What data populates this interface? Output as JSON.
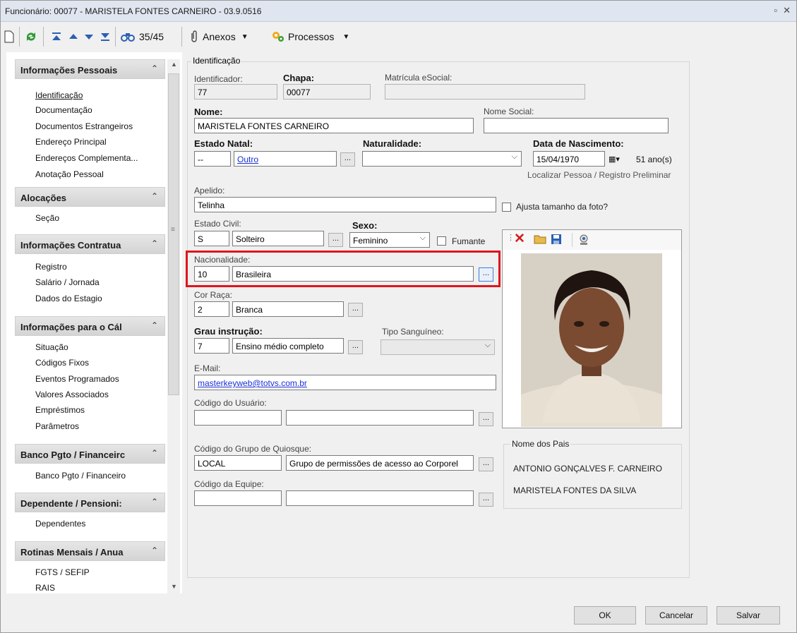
{
  "window": {
    "title": "Funcionário: 00077 - MARISTELA FONTES CARNEIRO - 03.9.0516"
  },
  "toolbar": {
    "counter": "35/45",
    "attachments_label": "Anexos",
    "processes_label": "Processos"
  },
  "sidebar": {
    "sections": [
      {
        "title": "Informações Pessoais",
        "items": [
          "Identificação",
          "Documentação",
          "Documentos Estrangeiros",
          "Endereço Principal",
          "Endereços Complementa...",
          "Anotação Pessoal"
        ]
      },
      {
        "title": "Alocações",
        "items": [
          "Seção"
        ]
      },
      {
        "title": "Informações Contratua",
        "items": [
          "Registro",
          "Salário / Jornada",
          "Dados do Estagio"
        ]
      },
      {
        "title": "Informações para o Cál",
        "items": [
          "Situação",
          "Códigos Fixos",
          "Eventos Programados",
          "Valores Associados",
          "Empréstimos",
          "Parâmetros"
        ]
      },
      {
        "title": "Banco Pgto / Financeirc",
        "items": [
          "Banco Pgto / Financeiro"
        ]
      },
      {
        "title": "Dependente / Pensioni:",
        "items": [
          "Dependentes"
        ]
      },
      {
        "title": "Rotinas Mensais / Anua",
        "items": [
          "FGTS / SEFIP",
          "RAIS"
        ]
      }
    ]
  },
  "form": {
    "group_title": "Identificação",
    "identificador_label": "Identificador:",
    "identificador": "77",
    "chapa_label": "Chapa:",
    "chapa": "00077",
    "matricula_label": "Matrícula eSocial:",
    "matricula": "",
    "nome_label": "Nome:",
    "nome": "MARISTELA FONTES CARNEIRO",
    "nome_social_label": "Nome Social:",
    "nome_social": "",
    "estado_natal_label_a": "Estado",
    "estado_natal_label_b": "Natal:",
    "estado_natal_code": "--",
    "estado_natal_desc": "Outro",
    "naturalidade_label": "Naturalidade:",
    "naturalidade": "",
    "nascimento_label": "Data de Nascimento:",
    "nascimento": "15/04/1970",
    "idade": "51 ano(s)",
    "localizar_link": "Localizar Pessoa / Registro Preliminar",
    "apelido_label": "Apelido:",
    "apelido": "Telinha",
    "ajusta_foto_label": "Ajusta tamanho da foto?",
    "estado_civil_label": "Estado Civil:",
    "estado_civil_code": "S",
    "estado_civil_desc": "Solteiro",
    "sexo_label": "Sexo:",
    "sexo": "Feminino",
    "fumante_label": "Fumante",
    "nacionalidade_label": "Nacionalidade:",
    "nacionalidade_code": "10",
    "nacionalidade_desc": "Brasileira",
    "cor_raca_label": "Cor Raça:",
    "cor_raca_code": "2",
    "cor_raca_desc": "Branca",
    "grau_label": "Grau instrução:",
    "grau_code": "7",
    "grau_desc": "Ensino médio completo",
    "tipo_sangue_label": "Tipo Sanguíneo:",
    "tipo_sangue": "",
    "email_label": "E-Mail:",
    "email": "masterkeyweb@totvs.com.br",
    "cod_usuario_label": "Código do Usuário:",
    "cod_usuario": "",
    "cod_usuario_desc": "",
    "quiosque_label": "Código do Grupo de Quiosque:",
    "quiosque_code": "LOCAL",
    "quiosque_desc": "Grupo de permissões de acesso ao Corporel",
    "equipe_label": "Código da Equipe:",
    "equipe_code": "",
    "equipe_desc": "",
    "pais_title": "Nome dos Pais",
    "pai": "ANTONIO GONÇALVES F. CARNEIRO",
    "mae": "MARISTELA FONTES DA SILVA"
  },
  "buttons": {
    "ok": "OK",
    "cancel": "Cancelar",
    "save": "Salvar"
  },
  "colors": {
    "highlight": "#e0141e",
    "link": "#1b2fd4",
    "titlebar": "#dfe6ef"
  }
}
